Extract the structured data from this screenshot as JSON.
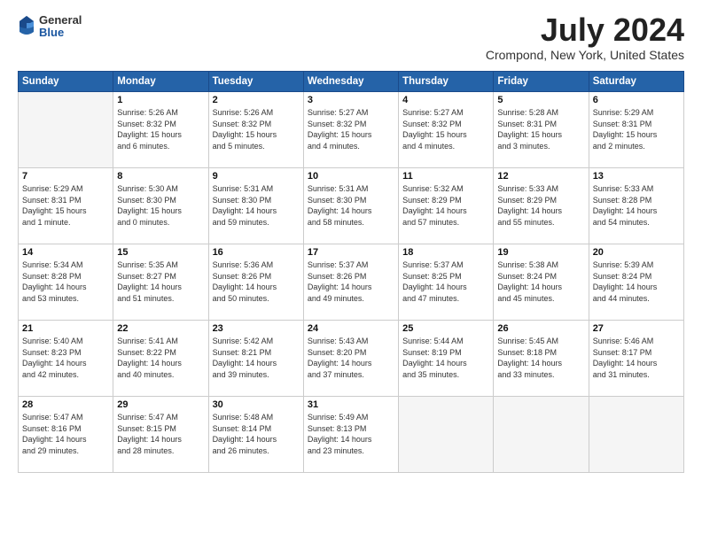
{
  "header": {
    "logo": {
      "general": "General",
      "blue": "Blue"
    },
    "title": "July 2024",
    "location": "Crompond, New York, United States"
  },
  "columns": [
    "Sunday",
    "Monday",
    "Tuesday",
    "Wednesday",
    "Thursday",
    "Friday",
    "Saturday"
  ],
  "weeks": [
    [
      {
        "day": "",
        "info": ""
      },
      {
        "day": "1",
        "info": "Sunrise: 5:26 AM\nSunset: 8:32 PM\nDaylight: 15 hours\nand 6 minutes."
      },
      {
        "day": "2",
        "info": "Sunrise: 5:26 AM\nSunset: 8:32 PM\nDaylight: 15 hours\nand 5 minutes."
      },
      {
        "day": "3",
        "info": "Sunrise: 5:27 AM\nSunset: 8:32 PM\nDaylight: 15 hours\nand 4 minutes."
      },
      {
        "day": "4",
        "info": "Sunrise: 5:27 AM\nSunset: 8:32 PM\nDaylight: 15 hours\nand 4 minutes."
      },
      {
        "day": "5",
        "info": "Sunrise: 5:28 AM\nSunset: 8:31 PM\nDaylight: 15 hours\nand 3 minutes."
      },
      {
        "day": "6",
        "info": "Sunrise: 5:29 AM\nSunset: 8:31 PM\nDaylight: 15 hours\nand 2 minutes."
      }
    ],
    [
      {
        "day": "7",
        "info": "Sunrise: 5:29 AM\nSunset: 8:31 PM\nDaylight: 15 hours\nand 1 minute."
      },
      {
        "day": "8",
        "info": "Sunrise: 5:30 AM\nSunset: 8:30 PM\nDaylight: 15 hours\nand 0 minutes."
      },
      {
        "day": "9",
        "info": "Sunrise: 5:31 AM\nSunset: 8:30 PM\nDaylight: 14 hours\nand 59 minutes."
      },
      {
        "day": "10",
        "info": "Sunrise: 5:31 AM\nSunset: 8:30 PM\nDaylight: 14 hours\nand 58 minutes."
      },
      {
        "day": "11",
        "info": "Sunrise: 5:32 AM\nSunset: 8:29 PM\nDaylight: 14 hours\nand 57 minutes."
      },
      {
        "day": "12",
        "info": "Sunrise: 5:33 AM\nSunset: 8:29 PM\nDaylight: 14 hours\nand 55 minutes."
      },
      {
        "day": "13",
        "info": "Sunrise: 5:33 AM\nSunset: 8:28 PM\nDaylight: 14 hours\nand 54 minutes."
      }
    ],
    [
      {
        "day": "14",
        "info": "Sunrise: 5:34 AM\nSunset: 8:28 PM\nDaylight: 14 hours\nand 53 minutes."
      },
      {
        "day": "15",
        "info": "Sunrise: 5:35 AM\nSunset: 8:27 PM\nDaylight: 14 hours\nand 51 minutes."
      },
      {
        "day": "16",
        "info": "Sunrise: 5:36 AM\nSunset: 8:26 PM\nDaylight: 14 hours\nand 50 minutes."
      },
      {
        "day": "17",
        "info": "Sunrise: 5:37 AM\nSunset: 8:26 PM\nDaylight: 14 hours\nand 49 minutes."
      },
      {
        "day": "18",
        "info": "Sunrise: 5:37 AM\nSunset: 8:25 PM\nDaylight: 14 hours\nand 47 minutes."
      },
      {
        "day": "19",
        "info": "Sunrise: 5:38 AM\nSunset: 8:24 PM\nDaylight: 14 hours\nand 45 minutes."
      },
      {
        "day": "20",
        "info": "Sunrise: 5:39 AM\nSunset: 8:24 PM\nDaylight: 14 hours\nand 44 minutes."
      }
    ],
    [
      {
        "day": "21",
        "info": "Sunrise: 5:40 AM\nSunset: 8:23 PM\nDaylight: 14 hours\nand 42 minutes."
      },
      {
        "day": "22",
        "info": "Sunrise: 5:41 AM\nSunset: 8:22 PM\nDaylight: 14 hours\nand 40 minutes."
      },
      {
        "day": "23",
        "info": "Sunrise: 5:42 AM\nSunset: 8:21 PM\nDaylight: 14 hours\nand 39 minutes."
      },
      {
        "day": "24",
        "info": "Sunrise: 5:43 AM\nSunset: 8:20 PM\nDaylight: 14 hours\nand 37 minutes."
      },
      {
        "day": "25",
        "info": "Sunrise: 5:44 AM\nSunset: 8:19 PM\nDaylight: 14 hours\nand 35 minutes."
      },
      {
        "day": "26",
        "info": "Sunrise: 5:45 AM\nSunset: 8:18 PM\nDaylight: 14 hours\nand 33 minutes."
      },
      {
        "day": "27",
        "info": "Sunrise: 5:46 AM\nSunset: 8:17 PM\nDaylight: 14 hours\nand 31 minutes."
      }
    ],
    [
      {
        "day": "28",
        "info": "Sunrise: 5:47 AM\nSunset: 8:16 PM\nDaylight: 14 hours\nand 29 minutes."
      },
      {
        "day": "29",
        "info": "Sunrise: 5:47 AM\nSunset: 8:15 PM\nDaylight: 14 hours\nand 28 minutes."
      },
      {
        "day": "30",
        "info": "Sunrise: 5:48 AM\nSunset: 8:14 PM\nDaylight: 14 hours\nand 26 minutes."
      },
      {
        "day": "31",
        "info": "Sunrise: 5:49 AM\nSunset: 8:13 PM\nDaylight: 14 hours\nand 23 minutes."
      },
      {
        "day": "",
        "info": ""
      },
      {
        "day": "",
        "info": ""
      },
      {
        "day": "",
        "info": ""
      }
    ]
  ]
}
